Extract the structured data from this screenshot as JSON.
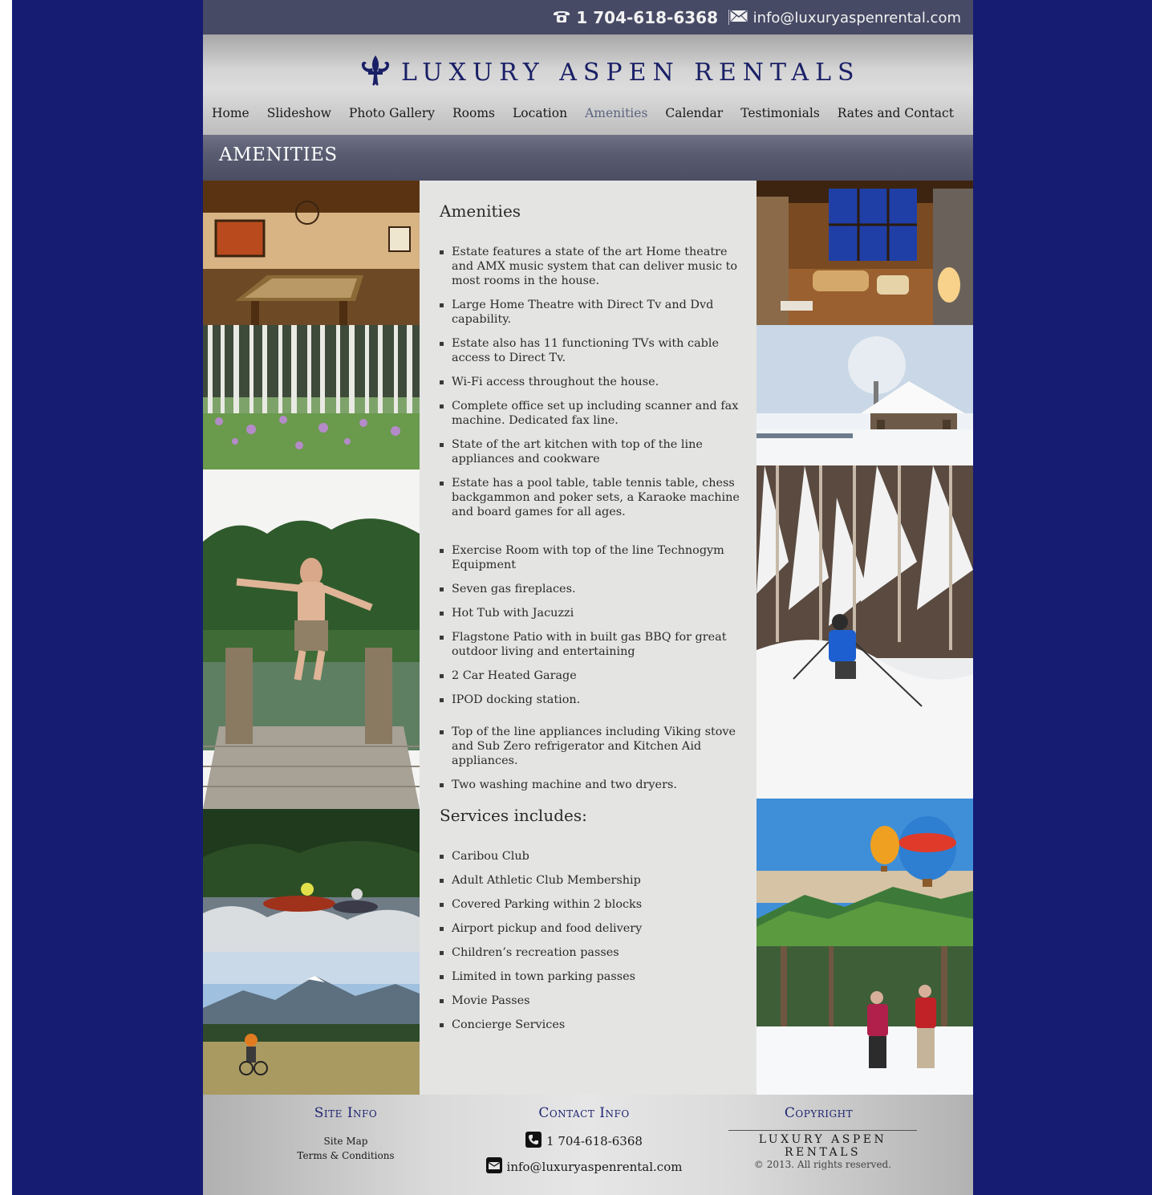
{
  "topbar": {
    "phone": "1 704-618-6368",
    "email": "info@luxuryaspenrental.com"
  },
  "brand": {
    "logo_text": "LUXURY ASPEN RENTALS"
  },
  "nav": {
    "items": [
      {
        "label": "Home"
      },
      {
        "label": "Slideshow"
      },
      {
        "label": "Photo Gallery"
      },
      {
        "label": "Rooms"
      },
      {
        "label": "Location"
      },
      {
        "label": "Amenities",
        "active": true
      },
      {
        "label": "Calendar"
      },
      {
        "label": "Testimonials"
      },
      {
        "label": "Rates and Contact"
      }
    ]
  },
  "page_title": "AMENITIES",
  "amenities": {
    "heading": "Amenities",
    "items": [
      "Estate features a state of the art Home theatre and AMX music system that can deliver music to most rooms in the house.",
      "Large Home Theatre with Direct Tv and Dvd capability.",
      "Estate also has 11 functioning TVs with cable access to Direct Tv.",
      "Wi-Fi access throughout the house.",
      "Complete office set up including scanner and fax machine. Dedicated fax line.",
      "State of the art kitchen with top of the line appliances and cookware",
      "Estate has a pool table, table tennis table, chess backgammon and poker sets, a Karaoke machine and board games for all ages.",
      "Exercise Room with top of the line Technogym Equipment",
      "Seven gas fireplaces.",
      "Hot Tub with Jacuzzi",
      "Flagstone Patio with in built gas BBQ for great outdoor living and entertaining",
      "2 Car Heated Garage",
      "IPOD docking station.",
      "Top of the line appliances including Viking stove and Sub Zero refrigerator and Kitchen Aid appliances.",
      "Two washing machine and two dryers."
    ]
  },
  "services": {
    "heading": "Services includes:",
    "items": [
      "Caribou Club",
      "Adult Athletic Club Membership",
      "Covered Parking within 2 blocks",
      "Airport pickup and food delivery",
      "Children’s recreation passes",
      "Limited in town parking passes",
      "Movie Passes",
      "Concierge Services"
    ]
  },
  "footer": {
    "site_info": {
      "heading": "Site Info",
      "links": [
        "Site Map",
        "Terms & Conditions"
      ]
    },
    "contact_info": {
      "heading": "Contact Info",
      "phone": "1 704-618-6368",
      "email": "info@luxuryaspenrental.com"
    },
    "copyright": {
      "heading": "Copyright",
      "brand": "LUXURY ASPEN RENTALS",
      "text": "© 2013. All rights reserved."
    }
  },
  "colors": {
    "outer_background": "#161c72",
    "topbar": "#474a65",
    "brand_navy": "#1a2066",
    "content_bg": "#e4e4e3"
  }
}
